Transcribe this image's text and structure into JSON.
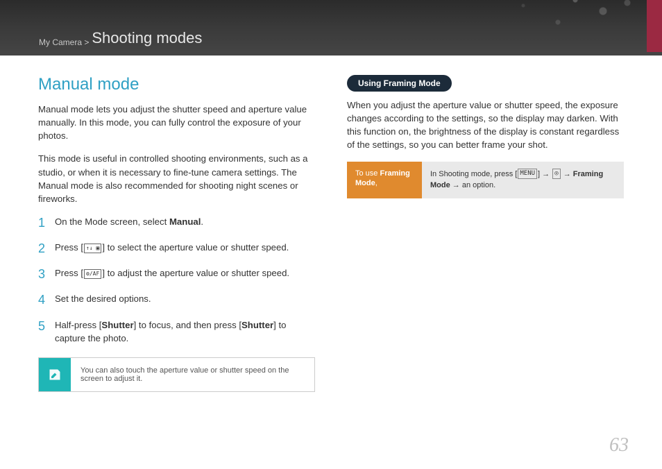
{
  "breadcrumb": {
    "pre": "My Camera >",
    "main": "Shooting modes"
  },
  "left": {
    "title": "Manual mode",
    "para1": "Manual mode lets you adjust the shutter speed and aperture value manually. In this mode, you can fully control the exposure of your photos.",
    "para2": "This mode is useful in controlled shooting environments, such as a studio, or when it is necessary to fine-tune camera settings. The Manual mode is also recommended for shooting night scenes or fireworks.",
    "steps": [
      {
        "a": "On the Mode screen, select ",
        "bold": "Manual",
        "b": "."
      },
      {
        "a": "Press [",
        "icon": "↑↓ ▣",
        "b": "] to select the aperture value or shutter speed."
      },
      {
        "a": "Press [",
        "icon": "⚙/AF",
        "b": "] to adjust the aperture value or shutter speed."
      },
      {
        "a": "Set the desired options."
      },
      {
        "a": "Half-press [",
        "bold": "Shutter",
        "b": "] to focus, and then press [",
        "bold2": "Shutter",
        "c": "] to capture the photo."
      }
    ],
    "tip": "You can also touch the aperture value or shutter speed on the screen to adjust it."
  },
  "right": {
    "pill": "Using Framing Mode",
    "para": "When you adjust the aperture value or shutter speed, the exposure changes according to the settings, so the display may darken. With this function on, the brightness of the display is constant regardless of the settings, so you can better frame your shot.",
    "action": {
      "label_a": "To use ",
      "label_b": "Framing Mode",
      "label_c": ",",
      "body_a": "In Shooting mode, press [",
      "icon1": "MENU",
      "body_b": "] → ",
      "icon2": "◎",
      "body_c": " → ",
      "bold": "Framing Mode",
      "body_d": " → an option."
    }
  },
  "page": "63"
}
